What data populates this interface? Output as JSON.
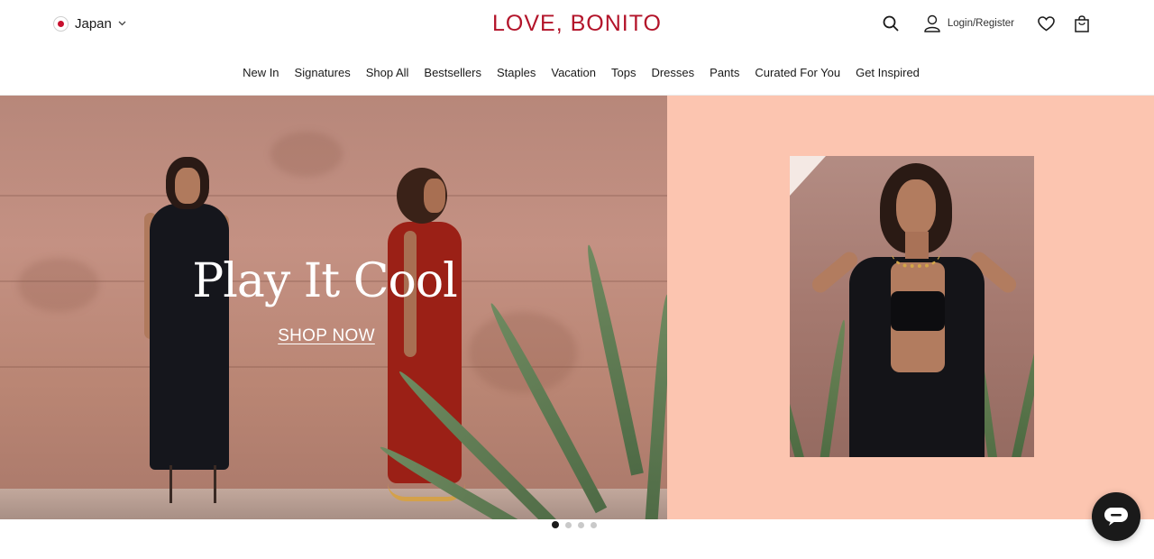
{
  "header": {
    "country": {
      "label": "Japan",
      "flag_icon": "japan-flag-icon"
    },
    "logo": "LOVE, BONITO",
    "utilities": {
      "search_icon": "search-icon",
      "login_label": "Login/Register",
      "wishlist_icon": "heart-icon",
      "bag_icon": "shopping-bag-icon"
    }
  },
  "nav": {
    "items": [
      {
        "label": "New In"
      },
      {
        "label": "Signatures"
      },
      {
        "label": "Shop All"
      },
      {
        "label": "Bestsellers"
      },
      {
        "label": "Staples"
      },
      {
        "label": "Vacation"
      },
      {
        "label": "Tops"
      },
      {
        "label": "Dresses"
      },
      {
        "label": "Pants"
      },
      {
        "label": "Curated For You"
      },
      {
        "label": "Get Inspired"
      }
    ]
  },
  "hero": {
    "title": "Play It Cool",
    "cta": "SHOP NOW",
    "right_panel_color": "#fcc5b0"
  },
  "carousel": {
    "total_slides": 4,
    "active_index": 0
  },
  "chat": {
    "icon": "chat-icon"
  },
  "colors": {
    "brand": "#b3142a",
    "text": "#1a1a1a"
  }
}
